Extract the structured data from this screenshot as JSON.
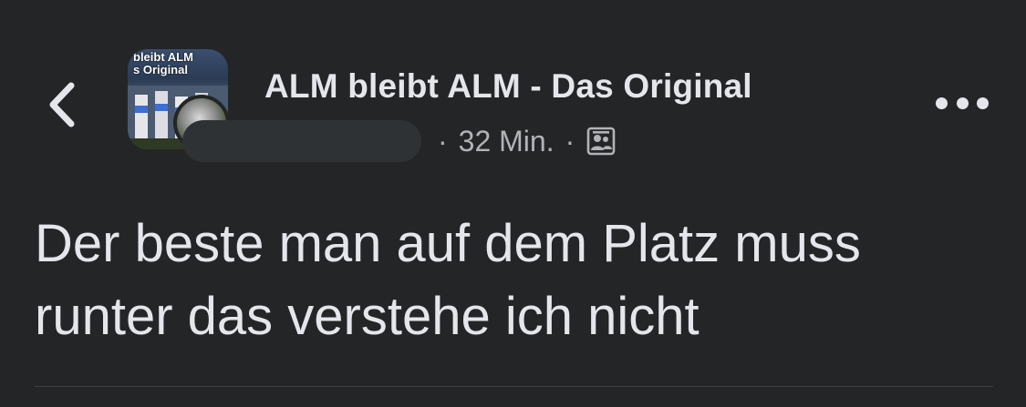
{
  "header": {
    "group_name": "ALM bleibt ALM - Das Original",
    "avatar_caption": "bleibt ALM\ns Original",
    "time": "32 Min.",
    "separator": "·"
  },
  "post": {
    "text_line1": "Der beste man auf dem Platz muss",
    "text_line2": "runter das verstehe ich nicht"
  },
  "icons": {
    "back": "chevron-left-icon",
    "audience": "group-members-icon",
    "more": "more-horizontal-icon"
  },
  "colors": {
    "background": "#242526",
    "primary_text": "#e4e6eb",
    "secondary_text": "#b0b3b8"
  }
}
